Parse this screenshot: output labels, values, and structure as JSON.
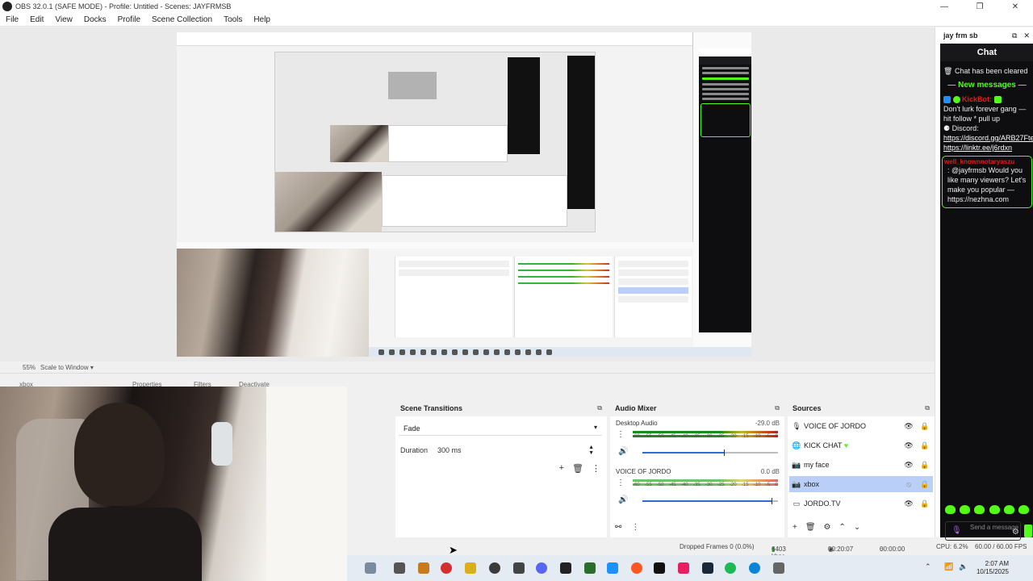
{
  "window": {
    "title": "OBS 32.0.1 (SAFE MODE) - Profile: Untitled - Scenes: JAYFRMSB",
    "controls": [
      "—",
      "❐",
      "✕"
    ]
  },
  "menu": [
    "File",
    "Edit",
    "View",
    "Docks",
    "Profile",
    "Scene Collection",
    "Tools",
    "Help"
  ],
  "preview_toolbar": {
    "zoom": "55%",
    "scale_mode": "Scale to Window"
  },
  "source_toolbar": {
    "source": "xbox",
    "properties": "Properties",
    "filters": "Filters",
    "deactivate": "Deactivate"
  },
  "scene_transitions": {
    "title": "Scene Transitions",
    "transition": "Fade",
    "duration_label": "Duration",
    "duration_value": "300 ms"
  },
  "audio_mixer": {
    "title": "Audio Mixer",
    "channels": [
      {
        "name": "Desktop Audio",
        "db": "-29.0 dB",
        "volume_fraction": 0.6
      },
      {
        "name": "VOICE OF JORDO",
        "db": "0.0 dB",
        "volume_fraction": 0.95
      }
    ],
    "scale": [
      "-60",
      "-55",
      "-50",
      "-45",
      "-40",
      "-35",
      "-30",
      "-25",
      "-20",
      "-15",
      "-10",
      "-5",
      "0"
    ]
  },
  "sources": {
    "title": "Sources",
    "items": [
      {
        "name": "VOICE OF JORDO",
        "icon": "mic-icon",
        "selected": false
      },
      {
        "name": "KICK CHAT",
        "icon": "browser-icon",
        "selected": false
      },
      {
        "name": "my face",
        "icon": "camera-icon",
        "selected": false
      },
      {
        "name": "xbox",
        "icon": "camera-icon",
        "selected": true
      },
      {
        "name": "JORDO.TV",
        "icon": "window-icon",
        "selected": false
      }
    ]
  },
  "status": {
    "dropped_frames": "Dropped Frames 0 (0.0%)",
    "kbps": "6403 kbps",
    "stream_time": "00:20:07",
    "record_time": "00:00:00",
    "cpu": "CPU: 6.2%",
    "fps": "60.00 / 60.00 FPS"
  },
  "taskbar": {
    "time": "2:07 AM",
    "date": "10/15/2025"
  },
  "chat_dock": {
    "title": "jay frm sb",
    "panel_title": "Chat",
    "cleared": "Chat has been cleared",
    "new_messages": "New messages",
    "bot_name": "KickBot:",
    "bot_message": "Don't lurk forever gang — hit follow * pull up",
    "discord_label": "Discord:",
    "discord_link": "https://discord.gg/ARB27Fte",
    "linktree": "https://linktr.ee/j6rdxn",
    "spam_user": "well_knownnotaryaszu",
    "spam_message": ": @jayfrmsb Would you like many viewers? Let's make you popular — https://nezhna.com",
    "input_placeholder": "Send a message",
    "accent": "#53fc18"
  },
  "colors": {
    "selection": "#b9cff8",
    "fader": "#2b6fd6",
    "kick_green": "#53fc18"
  }
}
